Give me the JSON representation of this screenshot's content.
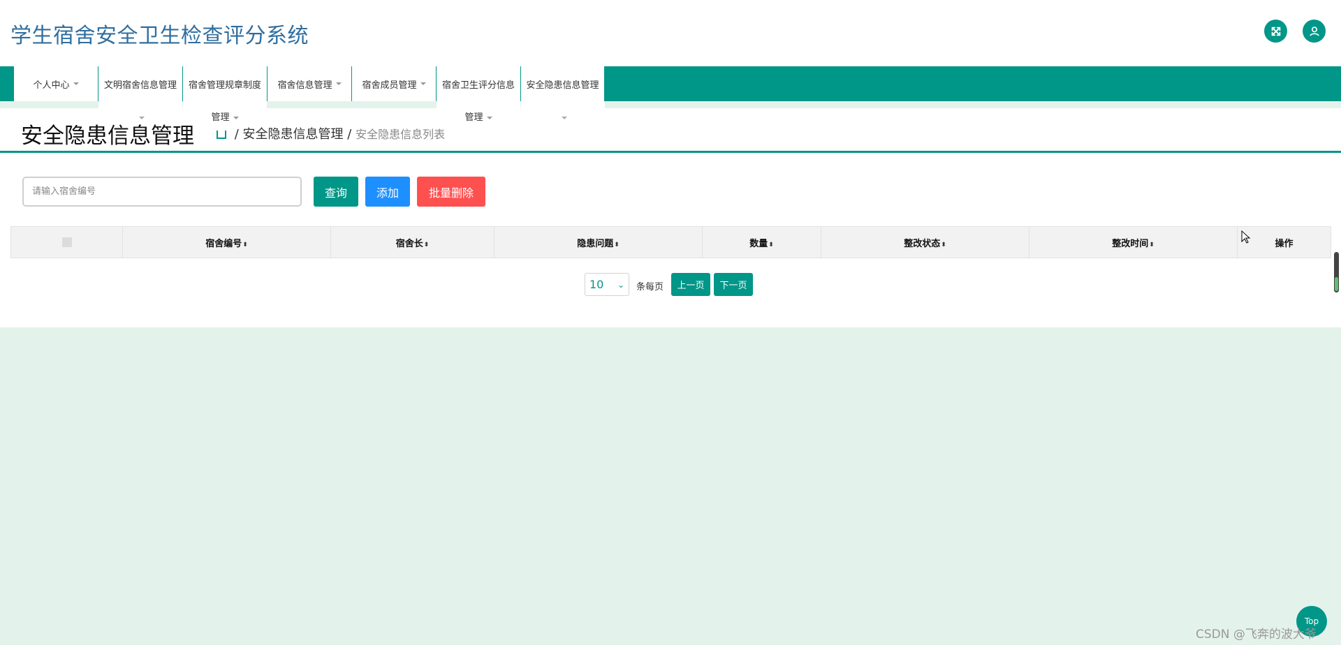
{
  "app": {
    "title": "学生宿舍安全卫生检查评分系统"
  },
  "header": {
    "fullscreen_icon": "expand-arrows-icon",
    "user_icon": "user-icon"
  },
  "nav": {
    "items": [
      {
        "label": "个人中心"
      },
      {
        "label": "文明宿舍信息管理"
      },
      {
        "label": "宿舍管理规章制度"
      },
      {
        "label": "宿舍信息管理"
      },
      {
        "label": "宿舍成员管理"
      },
      {
        "label": "宿舍卫生评分信息"
      },
      {
        "label": "安全隐患信息管理"
      }
    ],
    "continuations": {
      "rules": "管理",
      "hygiene": "管理"
    }
  },
  "page": {
    "title": "安全隐患信息管理",
    "breadcrumb": {
      "section": "安全隐患信息管理",
      "separator": "/",
      "current": "安全隐患信息列表"
    }
  },
  "search": {
    "placeholder": "请输入宿舍编号",
    "value": ""
  },
  "toolbar": {
    "query": "查询",
    "add": "添加",
    "batch_delete": "批量删除"
  },
  "table": {
    "columns": [
      "宿舍编号",
      "宿舍长",
      "隐患问题",
      "数量",
      "整改状态",
      "整改时间",
      "操作"
    ],
    "sort_glyph": "⬍",
    "rows": []
  },
  "pagination": {
    "page_size": "10",
    "per_page_label": "条每页",
    "prev": "上一页",
    "next": "下一页"
  },
  "floating": {
    "top": "Top"
  },
  "watermark": "CSDN @飞奔的波大爷",
  "colors": {
    "primary": "#009688",
    "add": "#1e8fff",
    "danger": "#ff5050",
    "title": "#2f6e9f",
    "background": "#e4f2ec"
  }
}
